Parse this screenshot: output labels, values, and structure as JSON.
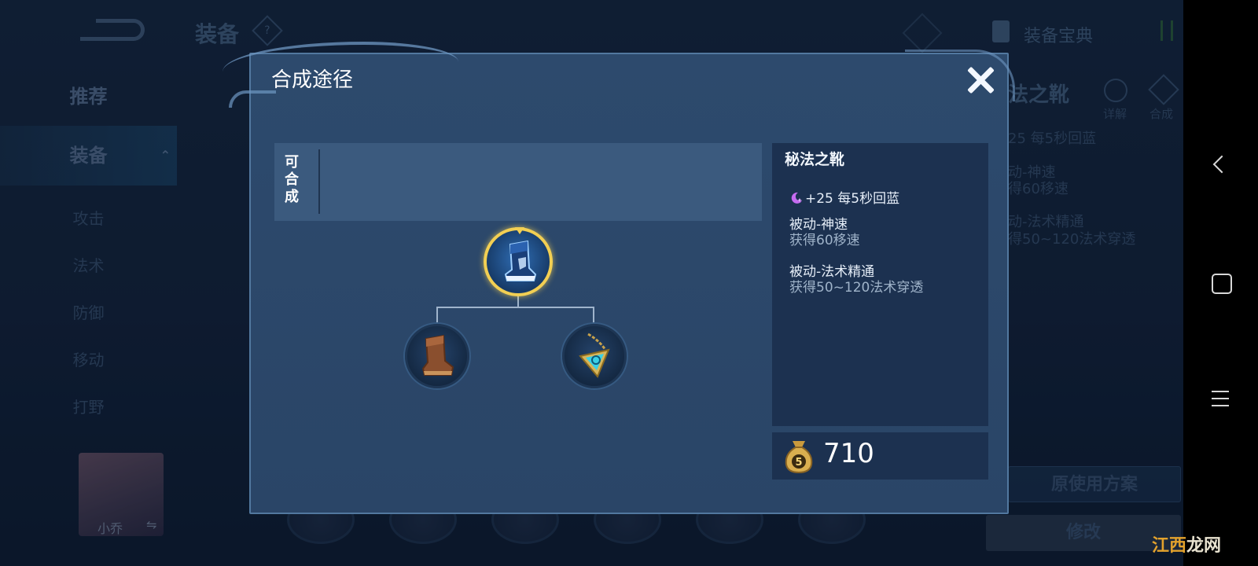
{
  "background": {
    "screen_title": "装备",
    "help_glyph": "?",
    "codex_label": "装备宝典",
    "sidebar": {
      "recommend": "推荐",
      "equipment": "装备",
      "categories": [
        "攻击",
        "法术",
        "防御",
        "移动",
        "打野"
      ]
    },
    "hero_name": "小乔",
    "swap_glyph": "⇋",
    "right_panel": {
      "item_title_partial": "法之靴",
      "detail_label": "详解",
      "compose_label": "合成",
      "lines": [
        "25 每5秒回蓝",
        "动-神速",
        "得60移速",
        "动-法术精通",
        "得50~120法术穿透"
      ]
    },
    "original_plan_button": "原使用方案",
    "edit_button": "修改"
  },
  "modal": {
    "title": "合成途径",
    "craftable_label": "可合成",
    "item_info": {
      "name": "秘法之靴",
      "stat": "+25 每5秒回蓝",
      "passives": [
        {
          "name": "被动-神速",
          "desc": "获得60移速"
        },
        {
          "name": "被动-法术精通",
          "desc": "获得50~120法术穿透"
        }
      ]
    },
    "price": "710",
    "coin_glyph": "5"
  },
  "watermark": {
    "part1": "江西",
    "part2": "龙网"
  },
  "colors": {
    "accent_gold": "#f2cf53",
    "modal_bg": "#2d4a6d",
    "panel_bg": "#1c3150",
    "mana_icon": "#c56bf0"
  },
  "icons": [
    "close-icon",
    "mana-regen-icon",
    "gold-coin-bag-icon",
    "arcane-boots-icon",
    "boots-icon",
    "amulet-icon"
  ]
}
